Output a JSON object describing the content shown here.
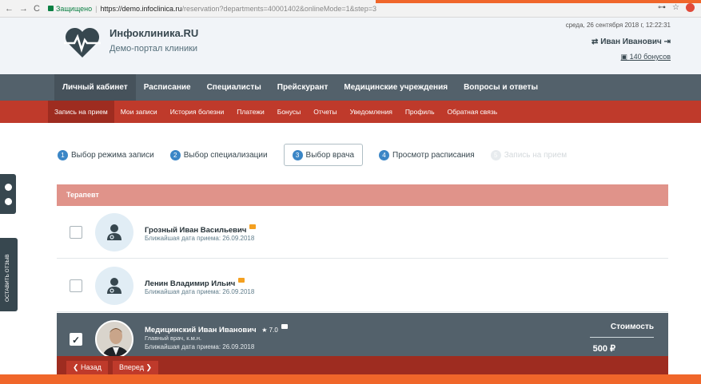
{
  "browser": {
    "nav_back": "←",
    "nav_forward": "→",
    "nav_reload": "C",
    "secure_label": "Защищено",
    "url_host": "https://demo.infoclinica.ru",
    "url_path": "/reservation?departments=40001402&onlineMode=1&step=3"
  },
  "header": {
    "site_title": "Инфоклиника.RU",
    "site_subtitle": "Демо-портал клиники",
    "datetime": "среда, 26 сентября 2018 г, 12:22:31",
    "user_name": "Иван Иванович",
    "bonus": "140 бонусов"
  },
  "main_nav": [
    {
      "label": "Личный кабинет",
      "active": true
    },
    {
      "label": "Расписание"
    },
    {
      "label": "Специалисты"
    },
    {
      "label": "Прейскурант"
    },
    {
      "label": "Медицинские учреждения"
    },
    {
      "label": "Вопросы и ответы"
    }
  ],
  "sub_nav": [
    {
      "label": "Запись на прием",
      "active": true
    },
    {
      "label": "Мои записи"
    },
    {
      "label": "История болезни"
    },
    {
      "label": "Платежи"
    },
    {
      "label": "Бонусы"
    },
    {
      "label": "Отчеты"
    },
    {
      "label": "Уведомления"
    },
    {
      "label": "Профиль"
    },
    {
      "label": "Обратная связь"
    }
  ],
  "steps": [
    {
      "num": "1",
      "label": "Выбор режима записи"
    },
    {
      "num": "2",
      "label": "Выбор специализации"
    },
    {
      "num": "3",
      "label": "Выбор врача"
    },
    {
      "num": "4",
      "label": "Просмотр расписания"
    },
    {
      "num": "5",
      "label": "Запись на прием"
    }
  ],
  "specialty": "Терапевт",
  "doctors": [
    {
      "name": "Грозный Иван Васильевич",
      "next_date": "Ближайшая дата приема: 26.09.2018"
    },
    {
      "name": "Ленин Владимир Ильич",
      "next_date": "Ближайшая дата приема: 26.09.2018"
    },
    {
      "name": "Медицинский Иван Иванович",
      "rating": "7.0",
      "title": "Главный врач, к.м.н.",
      "next_date": "Ближайшая дата приема: 26.09.2018",
      "price_label": "Стоимость",
      "price": "500 ₽"
    }
  ],
  "buttons": {
    "back": "❮ Назад",
    "next": "Вперед ❯"
  },
  "side": {
    "feedback": "ОСТАВИТЬ ОТЗЫВ"
  },
  "colors": {
    "nav_dark": "#53616b",
    "accent_red": "#bf3a2b",
    "accent_orange": "#f0662a",
    "step_blue": "#3b86c6",
    "specialty_bg": "#e0938a"
  }
}
